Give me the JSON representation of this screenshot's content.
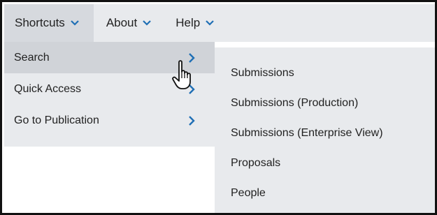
{
  "menubar": {
    "items": [
      {
        "label": "Shortcuts",
        "icon": "chevron-down-icon",
        "active": true
      },
      {
        "label": "About",
        "icon": "chevron-down-icon",
        "active": false
      },
      {
        "label": "Help",
        "icon": "chevron-down-icon",
        "active": false
      }
    ]
  },
  "shortcuts_menu": {
    "items": [
      {
        "label": "Search",
        "icon": "chevron-right-icon",
        "hovered": true
      },
      {
        "label": "Quick Access",
        "icon": "chevron-right-icon"
      },
      {
        "label": "Go to Publication",
        "icon": "chevron-right-icon"
      }
    ]
  },
  "search_flyout": {
    "items": [
      {
        "label": "Submissions"
      },
      {
        "label": "Submissions (Production)"
      },
      {
        "label": "Submissions (Enterprise View)"
      },
      {
        "label": "Proposals"
      },
      {
        "label": "People"
      }
    ]
  },
  "colors": {
    "menu_background": "#e8eaed",
    "active_background": "#d6d9de",
    "hover_background": "#d0d3d8",
    "chevron": "#1f6fb5",
    "text": "#222222",
    "border": "#111111"
  },
  "cursor": {
    "icon": "hand-pointer-icon"
  }
}
